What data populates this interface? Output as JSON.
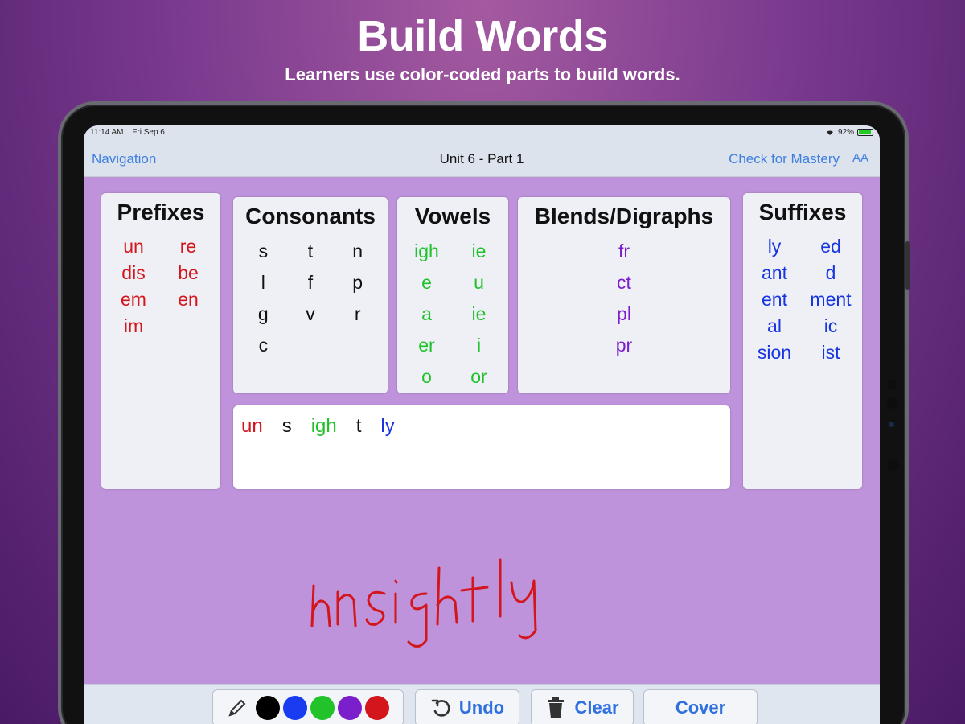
{
  "promo": {
    "title": "Build Words",
    "subtitle": "Learners use color-coded parts to build words."
  },
  "status_bar": {
    "time": "11:14 AM",
    "date": "Fri Sep 6",
    "battery": "92%"
  },
  "nav": {
    "left": "Navigation",
    "title": "Unit 6 - Part 1",
    "right": "Check for Mastery",
    "font_button": "AA"
  },
  "panels": {
    "prefixes": {
      "title": "Prefixes",
      "items": [
        "un",
        "re",
        "dis",
        "be",
        "em",
        "en",
        "im"
      ]
    },
    "consonants": {
      "title": "Consonants",
      "items": [
        "s",
        "t",
        "n",
        "l",
        "f",
        "p",
        "g",
        "v",
        "r",
        "c"
      ]
    },
    "vowels": {
      "title": "Vowels",
      "items": [
        "igh",
        "ie",
        "e",
        "u",
        "a",
        "ie",
        "er",
        "i",
        "o",
        "or"
      ]
    },
    "blends": {
      "title": "Blends/Digraphs",
      "items": [
        "fr",
        "ct",
        "pl",
        "pr"
      ]
    },
    "suffixes": {
      "title": "Suffixes",
      "items": [
        "ly",
        "ed",
        "ant",
        "d",
        "ent",
        "ment",
        "al",
        "ic",
        "sion",
        "ist"
      ]
    }
  },
  "build_area": {
    "parts": [
      {
        "text": "un",
        "category": "prefix"
      },
      {
        "text": "s",
        "category": "consonant"
      },
      {
        "text": "igh",
        "category": "vowel"
      },
      {
        "text": "t",
        "category": "consonant"
      },
      {
        "text": "ly",
        "category": "suffix"
      }
    ]
  },
  "handwriting": {
    "text": "unsightly",
    "color": "#d3161c"
  },
  "toolbar": {
    "pen_icon": "pencil-icon",
    "colors": [
      "#000000",
      "#1a3cf0",
      "#22c22a",
      "#7b1fcc",
      "#d3161c"
    ],
    "undo_label": "Undo",
    "clear_label": "Clear",
    "cover_label": "Cover"
  },
  "colors": {
    "prefix": "#d3161c",
    "consonant": "#111111",
    "vowel": "#20c22a",
    "blend": "#7b1fcc",
    "suffix": "#1735e0",
    "link": "#3d7fe0",
    "workspace": "#bf93db"
  }
}
